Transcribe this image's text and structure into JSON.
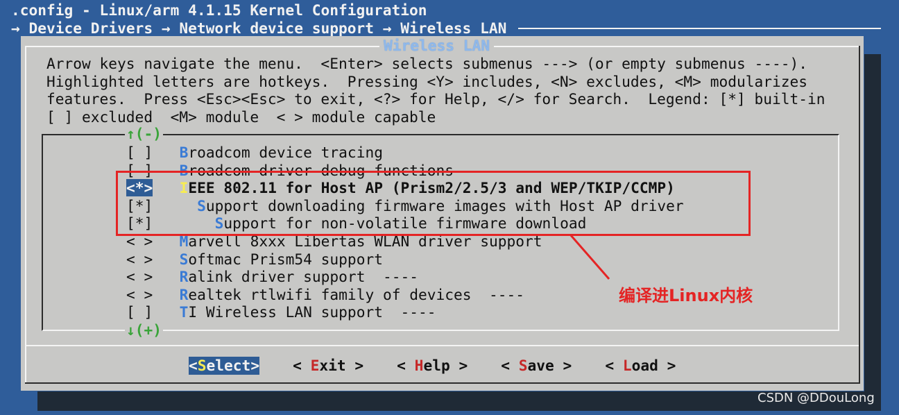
{
  "window": {
    "title": ".config - Linux/arm 4.1.15 Kernel Configuration",
    "breadcrumb": "→ Device Drivers → Network device support → Wireless LAN"
  },
  "dialog": {
    "title": "Wireless LAN",
    "help_lines": [
      "Arrow keys navigate the menu.  <Enter> selects submenus ---> (or empty submenus ----).",
      "Highlighted letters are hotkeys.  Pressing <Y> includes, <N> excludes, <M> modularizes",
      "features.  Press <Esc><Esc> to exit, <?> for Help, </> for Search.  Legend: [*] built-in",
      "[ ] excluded  <M> module  < > module capable"
    ],
    "scroll_up": "↑(-)",
    "scroll_down": "↓(+)"
  },
  "menu": {
    "items": [
      {
        "prefix": "[ ]",
        "indent": "",
        "hotkey": "B",
        "rest": "roadcom device tracing"
      },
      {
        "prefix": "[ ]",
        "indent": "",
        "hotkey": "B",
        "rest": "roadcom driver debug functions"
      },
      {
        "prefix": "<*>",
        "indent": "",
        "hotkey": "I",
        "rest": "EEE 802.11 for Host AP (Prism2/2.5/3 and WEP/TKIP/CCMP)",
        "selected": true
      },
      {
        "prefix": "[*]",
        "indent": "  ",
        "hotkey": "S",
        "rest": "upport downloading firmware images with Host AP driver"
      },
      {
        "prefix": "[*]",
        "indent": "    ",
        "hotkey": "S",
        "rest": "upport for non-volatile firmware download"
      },
      {
        "prefix": "< >",
        "indent": "",
        "hotkey": "M",
        "rest": "arvell 8xxx Libertas WLAN driver support"
      },
      {
        "prefix": "< >",
        "indent": "",
        "hotkey": "S",
        "rest": "oftmac Prism54 support"
      },
      {
        "prefix": "< >",
        "indent": "",
        "hotkey": "R",
        "rest": "alink driver support  ----"
      },
      {
        "prefix": "< >",
        "indent": "",
        "hotkey": "R",
        "rest": "ealtek rtlwifi family of devices  ----"
      },
      {
        "prefix": "[ ]",
        "indent": "",
        "hotkey": "T",
        "rest": "I Wireless LAN support  ----"
      }
    ]
  },
  "buttons": [
    {
      "open": "<",
      "hotkey": "S",
      "rest": "elect",
      "close": ">",
      "active": true
    },
    {
      "open": "< ",
      "hotkey": "E",
      "rest": "xit",
      "close": " >",
      "active": false
    },
    {
      "open": "< ",
      "hotkey": "H",
      "rest": "elp",
      "close": " >",
      "active": false
    },
    {
      "open": "< ",
      "hotkey": "S",
      "rest": "ave",
      "close": " >",
      "active": false
    },
    {
      "open": "< ",
      "hotkey": "L",
      "rest": "oad",
      "close": " >",
      "active": false
    }
  ],
  "annotation": {
    "text": "编译进Linux内核",
    "color": "#e42424"
  },
  "watermark": "CSDN @DDouLong",
  "colors": {
    "background": "#2f5d9a",
    "dialog": "#c8c8c6",
    "selection": "#2e5c95",
    "hotkey": "#3a7bd5",
    "button_hotkey": "#c62828",
    "scroll_indicator": "#3aa43a"
  }
}
